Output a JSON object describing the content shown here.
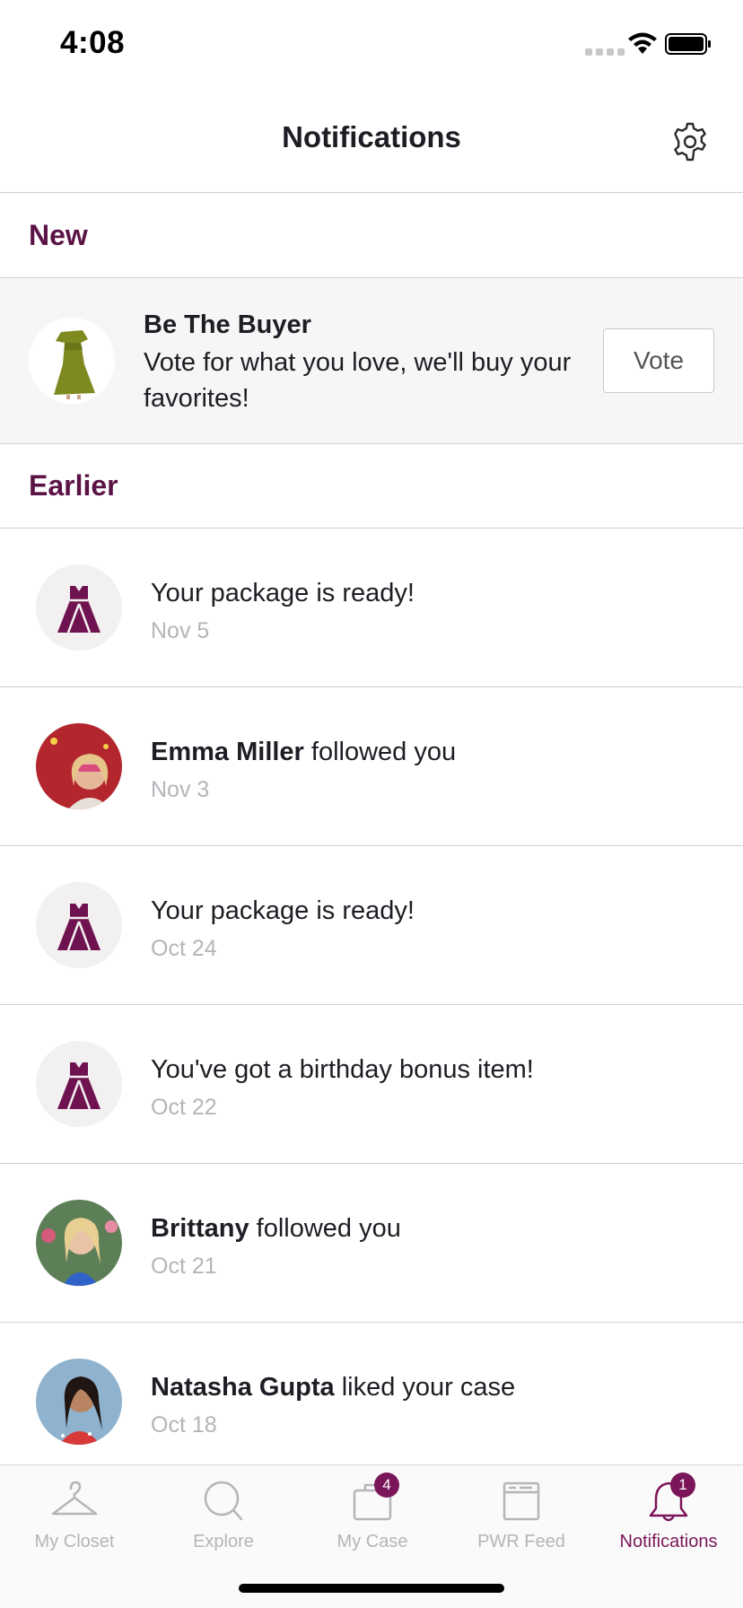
{
  "status_bar": {
    "time": "4:08"
  },
  "header": {
    "title": "Notifications",
    "settings_icon": "gear-icon"
  },
  "sections": {
    "new_label": "New",
    "earlier_label": "Earlier"
  },
  "featured": {
    "title": "Be The Buyer",
    "body": "Vote for what you love, we'll buy your favorites!",
    "button_label": "Vote",
    "thumbnail_icon": "green-dress-image"
  },
  "notifications": [
    {
      "name": "",
      "text": "Your package is ready!",
      "date": "Nov 5",
      "avatar": "dress-icon"
    },
    {
      "name": "Emma Miller",
      "text": " followed you",
      "date": "Nov 3",
      "avatar": "user-avatar"
    },
    {
      "name": "",
      "text": "Your package is ready!",
      "date": "Oct 24",
      "avatar": "dress-icon"
    },
    {
      "name": "",
      "text": "You've got a birthday bonus item!",
      "date": "Oct 22",
      "avatar": "dress-icon"
    },
    {
      "name": "Brittany",
      "text": " followed you",
      "date": "Oct 21",
      "avatar": "user-avatar"
    },
    {
      "name": "Natasha Gupta",
      "text": " liked your case",
      "date": "Oct 18",
      "avatar": "user-avatar"
    }
  ],
  "tab_bar": {
    "tabs": [
      {
        "label": "My Closet",
        "icon": "hanger-icon",
        "badge": ""
      },
      {
        "label": "Explore",
        "icon": "search-icon",
        "badge": ""
      },
      {
        "label": "My Case",
        "icon": "bag-icon",
        "badge": "4"
      },
      {
        "label": "PWR Feed",
        "icon": "feed-icon",
        "badge": ""
      },
      {
        "label": "Notifications",
        "icon": "bell-icon",
        "badge": "1"
      }
    ],
    "active_index": 4
  },
  "colors": {
    "accent": "#7a1559",
    "section_label": "#5b1346",
    "muted_text": "#b5b5ba",
    "tab_inactive": "#b5b5ba"
  }
}
